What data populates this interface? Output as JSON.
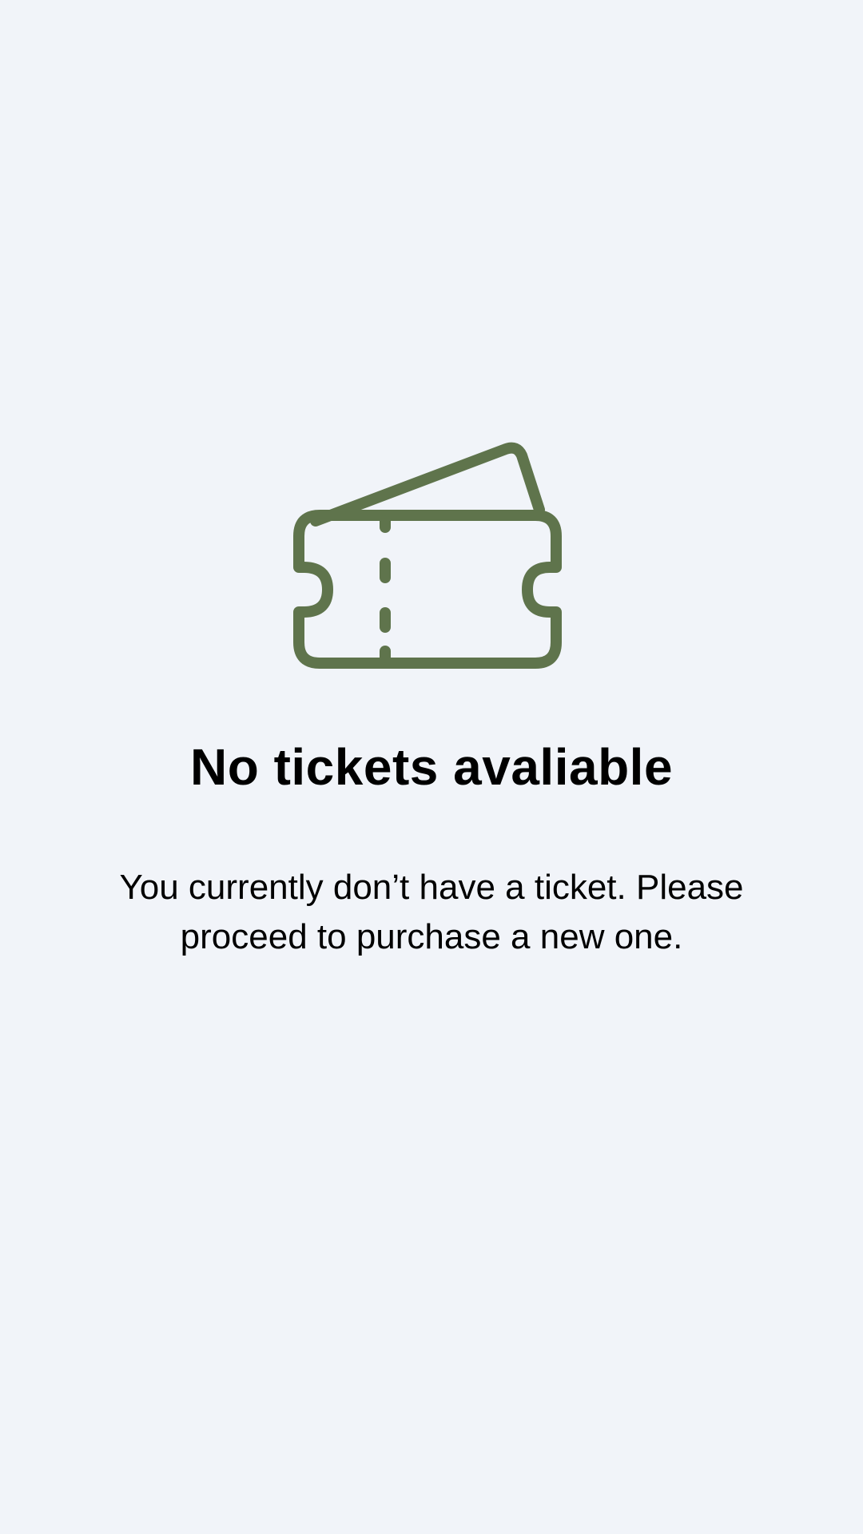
{
  "empty_state": {
    "icon": "ticket-icon",
    "icon_color": "#5f744c",
    "title": "No tickets avaliable",
    "message": "You currently don’t have a ticket. Please proceed to purchase a new one."
  },
  "background_color": "#f1f4f9"
}
